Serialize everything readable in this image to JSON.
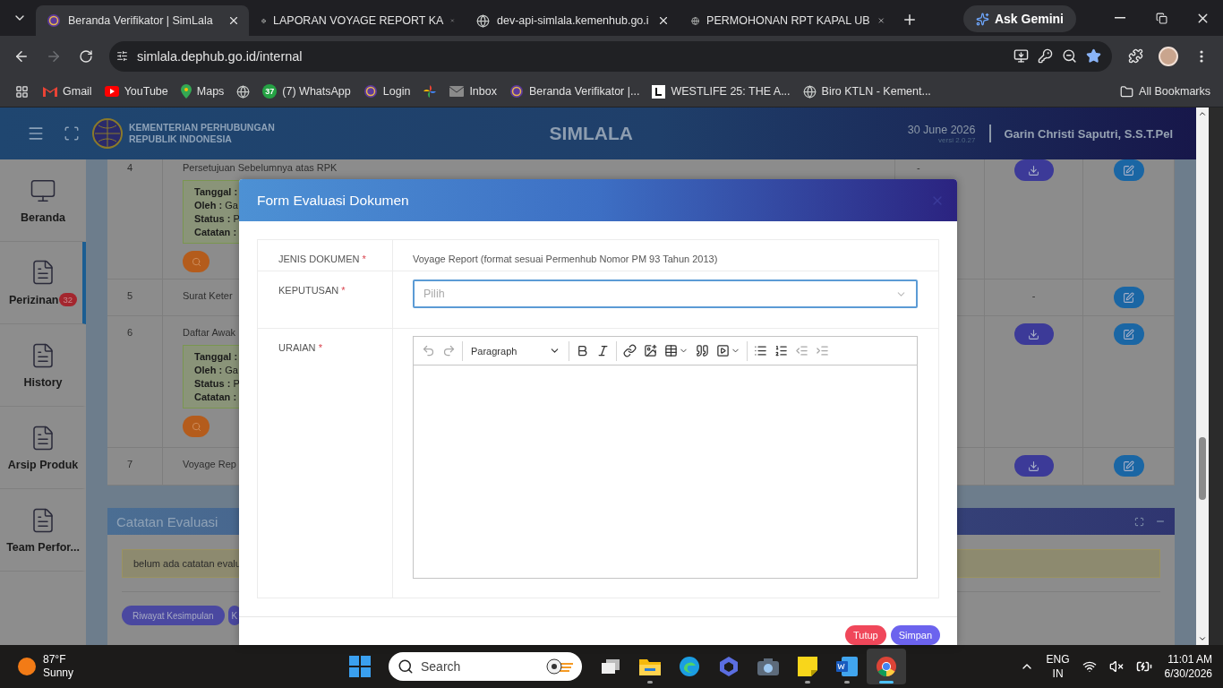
{
  "browser": {
    "tabs": [
      {
        "title": "Beranda Verifikator | SimLala",
        "selected": true,
        "kind": "site"
      },
      {
        "title": "LAPORAN VOYAGE REPORT KA",
        "selected": false,
        "kind": "globe"
      },
      {
        "title": "dev-api-simlala.kemenhub.go.i",
        "selected": false,
        "kind": "globe"
      },
      {
        "title": "PERMOHONAN RPT KAPAL UB",
        "selected": false,
        "kind": "globe"
      }
    ],
    "ask_gemini": "Ask Gemini",
    "url": "simlala.dephub.go.id/internal",
    "bookmarked": true,
    "bookmarks": [
      {
        "label": "Gmail",
        "kind": "mail"
      },
      {
        "label": "YouTube",
        "kind": "play"
      },
      {
        "label": "Maps",
        "kind": "pin"
      },
      {
        "kind": "globe"
      },
      {
        "label": "(7) WhatsApp",
        "kind": "count",
        "badge": "37"
      },
      {
        "label": "Login",
        "kind": "site"
      },
      {
        "kind": "pinwheel"
      },
      {
        "label": "Inbox",
        "kind": "envelope"
      },
      {
        "label": "Beranda Verifikator |...",
        "kind": "site"
      },
      {
        "label": "WESTLIFE 25: THE A...",
        "kind": "square"
      },
      {
        "label": "Biro KTLN - Kement...",
        "kind": "globe"
      }
    ],
    "all_bookmarks": "All Bookmarks"
  },
  "header": {
    "org_line1": "KEMENTERIAN PERHUBUNGAN",
    "org_line2": "REPUBLIK INDONESIA",
    "app_name": "SIMLALA",
    "date": "30 June 2026",
    "version": "versi 2.0.27",
    "user": "Garin Christi Saputri, S.S.T.Pel"
  },
  "sidebar": [
    {
      "label": "Beranda",
      "kind": "monitor",
      "selected": false
    },
    {
      "label": "Perizinan",
      "kind": "document",
      "badge": "32",
      "selected": true
    },
    {
      "label": "History",
      "kind": "document",
      "selected": false
    },
    {
      "label": "Arsip Produk",
      "kind": "document",
      "selected": false
    },
    {
      "label": "Team Perfor...",
      "kind": "document",
      "selected": false
    }
  ],
  "table": {
    "rows": [
      {
        "number": "4",
        "document": "Persetujuan Sebelumnya atas RPK",
        "details": [
          "**Tanggal :**",
          "**Oleh :** Ga",
          "**Status :** P",
          "**Catatan :**"
        ],
        "column_3": "-",
        "download": true
      },
      {
        "number": "5",
        "document": "Surat Keter",
        "file_text": "-",
        "download": false
      },
      {
        "number": "6",
        "document": "Daftar Awak",
        "details": [
          "**Tanggal :**",
          "**Oleh :** Ga",
          "**Status :** P",
          "**Catatan :**"
        ],
        "download": true
      },
      {
        "number": "7",
        "document": "Voyage Rep",
        "download": true
      }
    ]
  },
  "evaluation_notes": {
    "title": "Catatan Evaluasi",
    "message": "belum ada catatan evalu",
    "buttons": [
      "Riwayat Kesimpulan",
      "K"
    ]
  },
  "modal": {
    "title": "Form Evaluasi Dokumen",
    "required_mark": "*",
    "fields": [
      {
        "kind": "text",
        "label": "JENIS DOKUMEN",
        "required": true,
        "value": "Voyage Report (format sesuai Permenhub Nomor PM 93 Tahun 2013)"
      },
      {
        "kind": "select",
        "label": "KEPUTUSAN",
        "required": true,
        "placeholder": "Pilih",
        "focused": true
      },
      {
        "kind": "editor",
        "label": "URAIAN",
        "required": true,
        "block_style": "Paragraph",
        "toolbar": [
          {
            "kind": "undo",
            "disabled": true
          },
          {
            "kind": "redo",
            "disabled": true
          },
          {
            "kind": "style"
          },
          {
            "kind": "bold",
            "disabled": false
          },
          {
            "kind": "italic",
            "disabled": false
          },
          {
            "kind": "link",
            "disabled": false
          },
          {
            "kind": "image",
            "disabled": false
          },
          {
            "kind": "table",
            "disabled": false
          },
          {
            "kind": "quote",
            "disabled": false
          },
          {
            "kind": "media",
            "disabled": false
          },
          {
            "kind": "bullets",
            "disabled": false
          },
          {
            "kind": "numbers",
            "disabled": false
          },
          {
            "kind": "outdent",
            "disabled": true
          },
          {
            "kind": "indent",
            "disabled": true
          }
        ]
      }
    ],
    "buttons": [
      {
        "label": "Tutup",
        "kind": "cancel"
      },
      {
        "label": "Simpan",
        "kind": "primary"
      }
    ]
  },
  "taskbar": {
    "temperature": "87°F",
    "condition": "Sunny",
    "search_placeholder": "Search",
    "apps": [
      {
        "kind": "task-view",
        "running": false,
        "selected": false
      },
      {
        "kind": "files",
        "running": true,
        "selected": false
      },
      {
        "kind": "edge",
        "running": false,
        "selected": false
      },
      {
        "kind": "copilot",
        "running": false,
        "selected": false
      },
      {
        "kind": "camera",
        "running": false,
        "selected": false
      },
      {
        "kind": "notes",
        "running": true,
        "selected": false
      },
      {
        "kind": "word",
        "running": true,
        "selected": false
      },
      {
        "kind": "chrome",
        "running": true,
        "selected": true
      }
    ],
    "language": "ENG",
    "region": "IN",
    "time": "11:01 AM",
    "date": "6/30/2026"
  }
}
